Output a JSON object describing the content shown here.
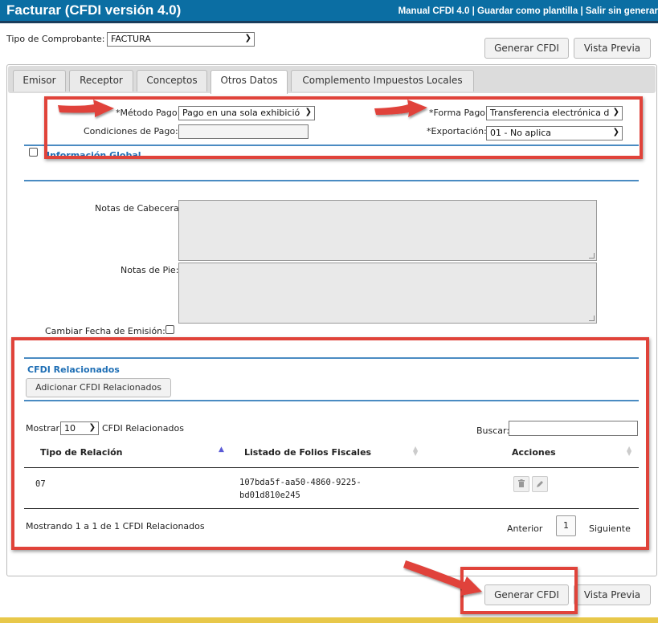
{
  "header": {
    "title": "Facturar (CFDI versión 4.0)",
    "link_manual": "Manual CFDI 4.0",
    "link_template": "Guardar como plantilla",
    "link_exit": "Salir sin generar",
    "separator": " | "
  },
  "top": {
    "tipo_label": "Tipo de Comprobante:",
    "tipo_value": "FACTURA",
    "generar_label": "Generar CFDI",
    "vista_label": "Vista Previa"
  },
  "tabs": [
    "Emisor",
    "Receptor",
    "Conceptos",
    "Otros Datos",
    "Complemento Impuestos Locales"
  ],
  "active_tab": "Otros Datos",
  "form": {
    "metodo_label": "*Método Pago:",
    "metodo_value": "Pago en una sola exhibició",
    "forma_label": "*Forma Pago:",
    "forma_value": "Transferencia electrónica d",
    "condiciones_label": "Condiciones de Pago:",
    "condiciones_value": "",
    "exportacion_label": "*Exportación:",
    "exportacion_value": "01 - No aplica",
    "info_global_label": "Información Global",
    "notas_cabecera_label": "Notas de Cabecera:",
    "notas_pie_label": "Notas de Pie:",
    "cambiar_fecha_label": "Cambiar Fecha de Emisión:"
  },
  "cfdi_rel": {
    "section_title": "CFDI Relacionados",
    "add_button": "Adicionar CFDI Relacionados",
    "mostrar_label": "Mostrar",
    "mostrar_value": "10",
    "mostrar_suffix": "CFDI Relacionados",
    "buscar_label": "Buscar:",
    "columns": [
      "Tipo de Relación",
      "Listado de Folios Fiscales",
      "Acciones"
    ],
    "rows": [
      {
        "tipo": "07",
        "folio_line1": "107bda5f-aa50-4860-9225-",
        "folio_line2": "bd01d810e245"
      }
    ],
    "footer_info": "Mostrando 1 a 1 de 1 CFDI Relacionados",
    "prev": "Anterior",
    "page": "1",
    "next": "Siguiente"
  },
  "bottom": {
    "generar_label": "Generar CFDI",
    "vista_label": "Vista Previa"
  },
  "colors": {
    "header_bg": "#0b6ea3",
    "annotation_red": "#e0433a",
    "accent_blue": "#4a8bc2",
    "footer_line": "#e8c84a"
  }
}
